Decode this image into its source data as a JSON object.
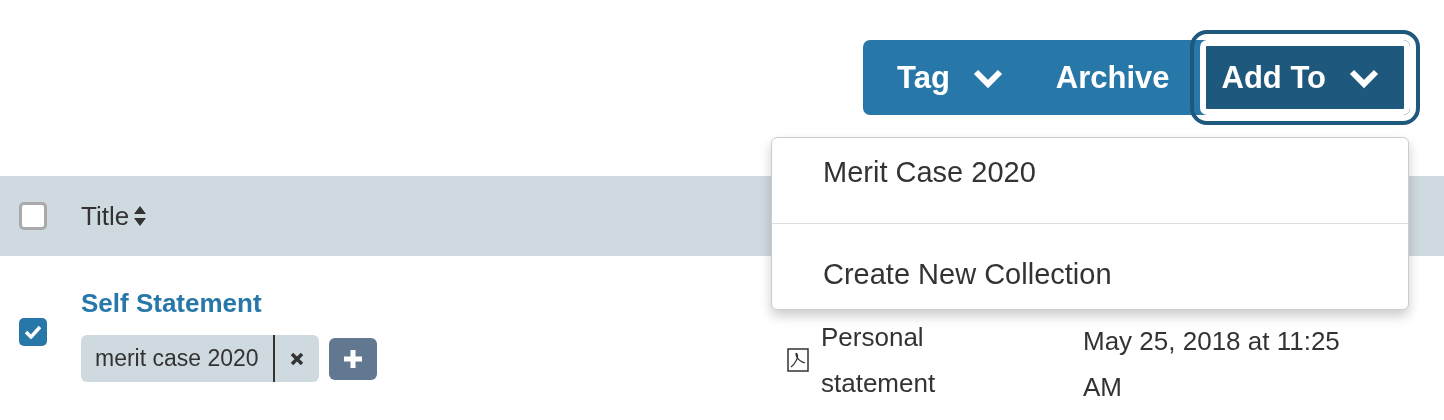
{
  "toolbar": {
    "buttons": [
      {
        "label": "Tag",
        "dropdown": true,
        "selected": false
      },
      {
        "label": "Archive",
        "dropdown": false,
        "selected": false
      },
      {
        "label": "Add To",
        "dropdown": true,
        "selected": true
      }
    ]
  },
  "menu": {
    "items": [
      {
        "label": "Merit Case 2020"
      },
      {
        "label": "Create New Collection"
      }
    ]
  },
  "table": {
    "select_all": {
      "checked": false
    },
    "columns": [
      {
        "label": "Title",
        "sortable": true
      }
    ],
    "rows": [
      {
        "checked": true,
        "title": "Self Statement",
        "tags": [
          "merit case 2020"
        ],
        "type": "Personal statement",
        "date": "May 25, 2018 at 11:25 AM"
      }
    ]
  }
}
